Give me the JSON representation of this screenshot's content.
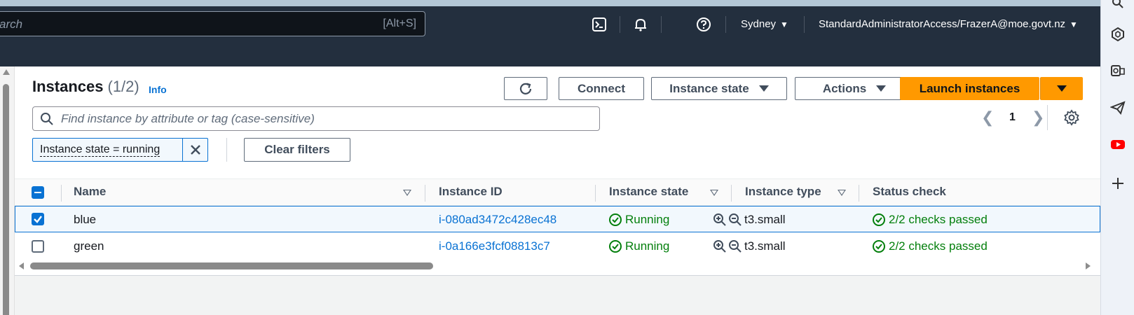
{
  "topnav": {
    "search_placeholder": "arch",
    "search_shortcut": "[Alt+S]",
    "region": "Sydney",
    "account": "StandardAdministratorAccess/FrazerA@moe.govt.nz"
  },
  "header": {
    "title": "Instances",
    "count": "(1/2)",
    "info": "Info"
  },
  "toolbar": {
    "connect": "Connect",
    "instance_state": "Instance state",
    "actions": "Actions",
    "launch": "Launch instances"
  },
  "filter": {
    "placeholder": "Find instance by attribute or tag (case-sensitive)",
    "token": "Instance state = running",
    "clear": "Clear filters"
  },
  "pagination": {
    "page": "1"
  },
  "table": {
    "columns": [
      "Name",
      "Instance ID",
      "Instance state",
      "Instance type",
      "Status check"
    ],
    "rows": [
      {
        "name": "blue",
        "id": "i-080ad3472c428ec48",
        "state": "Running",
        "type": "t3.small",
        "status": "2/2 checks passed",
        "selected": true
      },
      {
        "name": "green",
        "id": "i-0a166e3fcf08813c7",
        "state": "Running",
        "type": "t3.small",
        "status": "2/2 checks passed",
        "selected": false
      }
    ]
  },
  "colors": {
    "nav_bg": "#232f3e",
    "primary": "#ff9900",
    "link": "#0972d3",
    "success": "#037f0c"
  },
  "icons": [
    "cloudshell-icon",
    "bell-icon",
    "help-icon",
    "refresh-icon",
    "search-icon",
    "settings-gear-icon",
    "close-icon",
    "zoom-in-icon",
    "zoom-out-icon",
    "check-circle-icon"
  ]
}
